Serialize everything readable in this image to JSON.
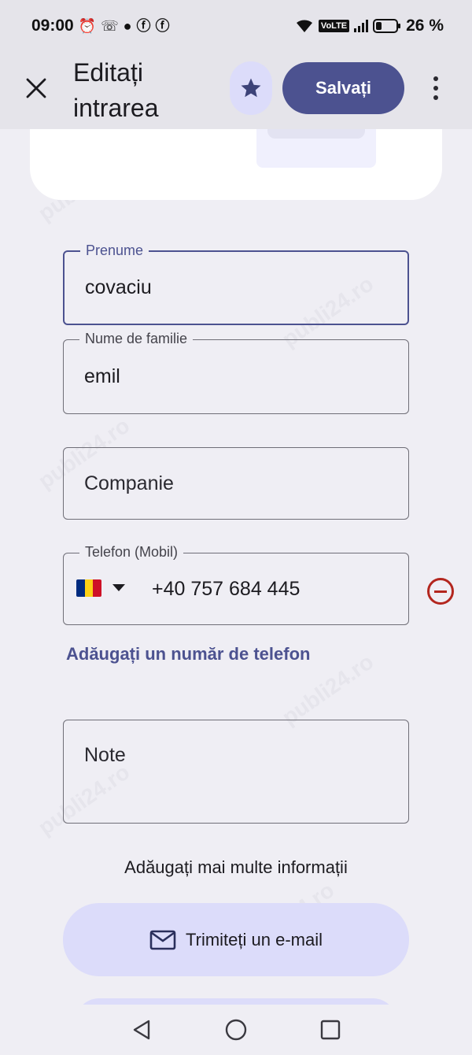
{
  "status_bar": {
    "time": "09:00",
    "network": "VoLTE",
    "battery_percent": "26 %"
  },
  "header": {
    "title": "Editați intrarea",
    "save_label": "Salvați",
    "close_icon": "close-icon",
    "star_icon": "star-icon",
    "menu_icon": "more-vert-icon"
  },
  "form": {
    "first_name": {
      "label": "Prenume",
      "value": "covaciu"
    },
    "last_name": {
      "label": "Nume de familie",
      "value": "emil"
    },
    "company": {
      "placeholder": "Companie"
    },
    "phone": {
      "label": "Telefon (Mobil)",
      "country": "RO",
      "value": "+40 757 684 445"
    },
    "add_phone_label": "Adăugați un număr de telefon",
    "notes": {
      "placeholder": "Note"
    },
    "more_info_label": "Adăugați mai multe informații",
    "email_button_label": "Trimiteți un e-mail"
  },
  "colors": {
    "accent": "#4c5290",
    "tonal": "#dcdcfa",
    "error": "#b3261e",
    "background": "#efeef4"
  },
  "watermark_text": "publi24.ro"
}
